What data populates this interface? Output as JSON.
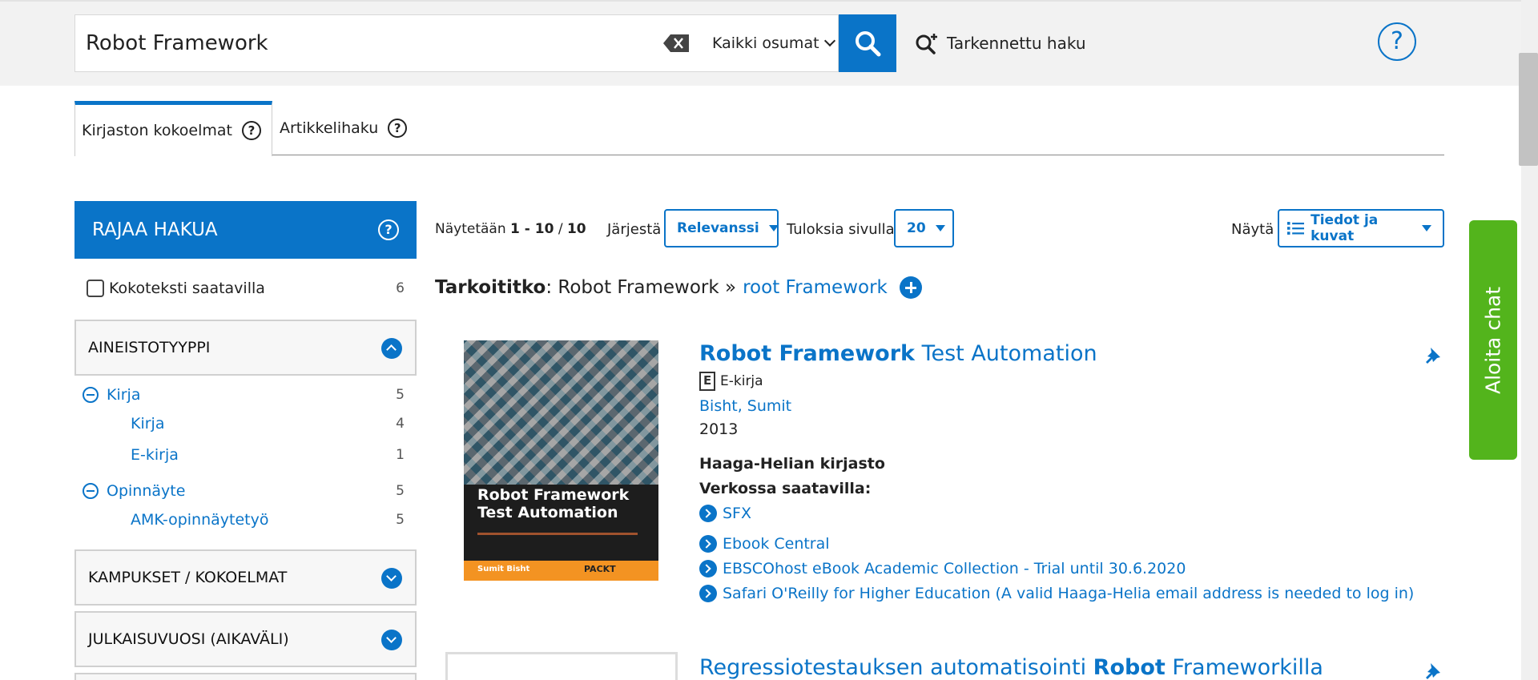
{
  "search": {
    "query": "Robot Framework",
    "scope": "Kaikki osumat",
    "advanced_label": "Tarkennettu haku",
    "help_symbol": "?"
  },
  "tabs": [
    {
      "label": "Kirjaston kokoelmat",
      "active": true
    },
    {
      "label": "Artikkelihaku",
      "active": false
    }
  ],
  "sidebar": {
    "title": "RAJAA HAKUA",
    "fulltext": {
      "label": "Kokoteksti saatavilla",
      "count": "6"
    },
    "facets": [
      {
        "title": "AINEISTOTYYPPI",
        "expanded": true
      },
      {
        "title": "KAMPUKSET / KOKOELMAT",
        "expanded": false
      },
      {
        "title": "JULKAISUVUOSI (AIKAVÄLI)",
        "expanded": false
      }
    ],
    "types": [
      {
        "label": "Kirja",
        "count": "5",
        "level": 0
      },
      {
        "label": "Kirja",
        "count": "4",
        "level": 1
      },
      {
        "label": "E-kirja",
        "count": "1",
        "level": 1
      },
      {
        "label": "Opinnäyte",
        "count": "5",
        "level": 0
      },
      {
        "label": "AMK-opinnäytetyö",
        "count": "5",
        "level": 1
      }
    ]
  },
  "results": {
    "showing_prefix": "Näytetään",
    "showing_range": "1 - 10",
    "showing_sep": "/",
    "showing_total": "10",
    "sort_label": "Järjestä",
    "sort_value": "Relevanssi",
    "per_page_label": "Tuloksia sivulla",
    "per_page_value": "20",
    "view_label": "Näytä",
    "view_value": "Tiedot ja kuvat",
    "didyoumean_label": "Tarkoititko",
    "didyoumean_query": ": Robot Framework »",
    "didyoumean_alt": "root Framework"
  },
  "records": [
    {
      "title_bold": "Robot Framework",
      "title_rest": " Test Automation",
      "format": "E-kirja",
      "author": "Bisht, Sumit",
      "year": "2013",
      "library": "Haaga-Helian kirjasto",
      "online_label": "Verkossa saatavilla:",
      "links": [
        "SFX",
        "Ebook Central",
        "EBSCOhost eBook Academic Collection - Trial until 30.6.2020",
        "Safari O'Reilly for Higher Education (A valid Haaga-Helia email address is needed to log in)"
      ],
      "cover": {
        "title_line1": "Robot Framework",
        "title_line2": "Test Automation",
        "author": "Sumit Bisht",
        "publisher": "PACKT"
      }
    },
    {
      "title_pre": "Regressiotestauksen automatisointi ",
      "title_bold": "Robot",
      "title_post": " Frameworkilla"
    }
  ],
  "chat": {
    "label": "Aloita chat"
  },
  "colors": {
    "accent": "#0a74c8",
    "chat": "#53b41c",
    "cover_strip": "#f39322"
  }
}
